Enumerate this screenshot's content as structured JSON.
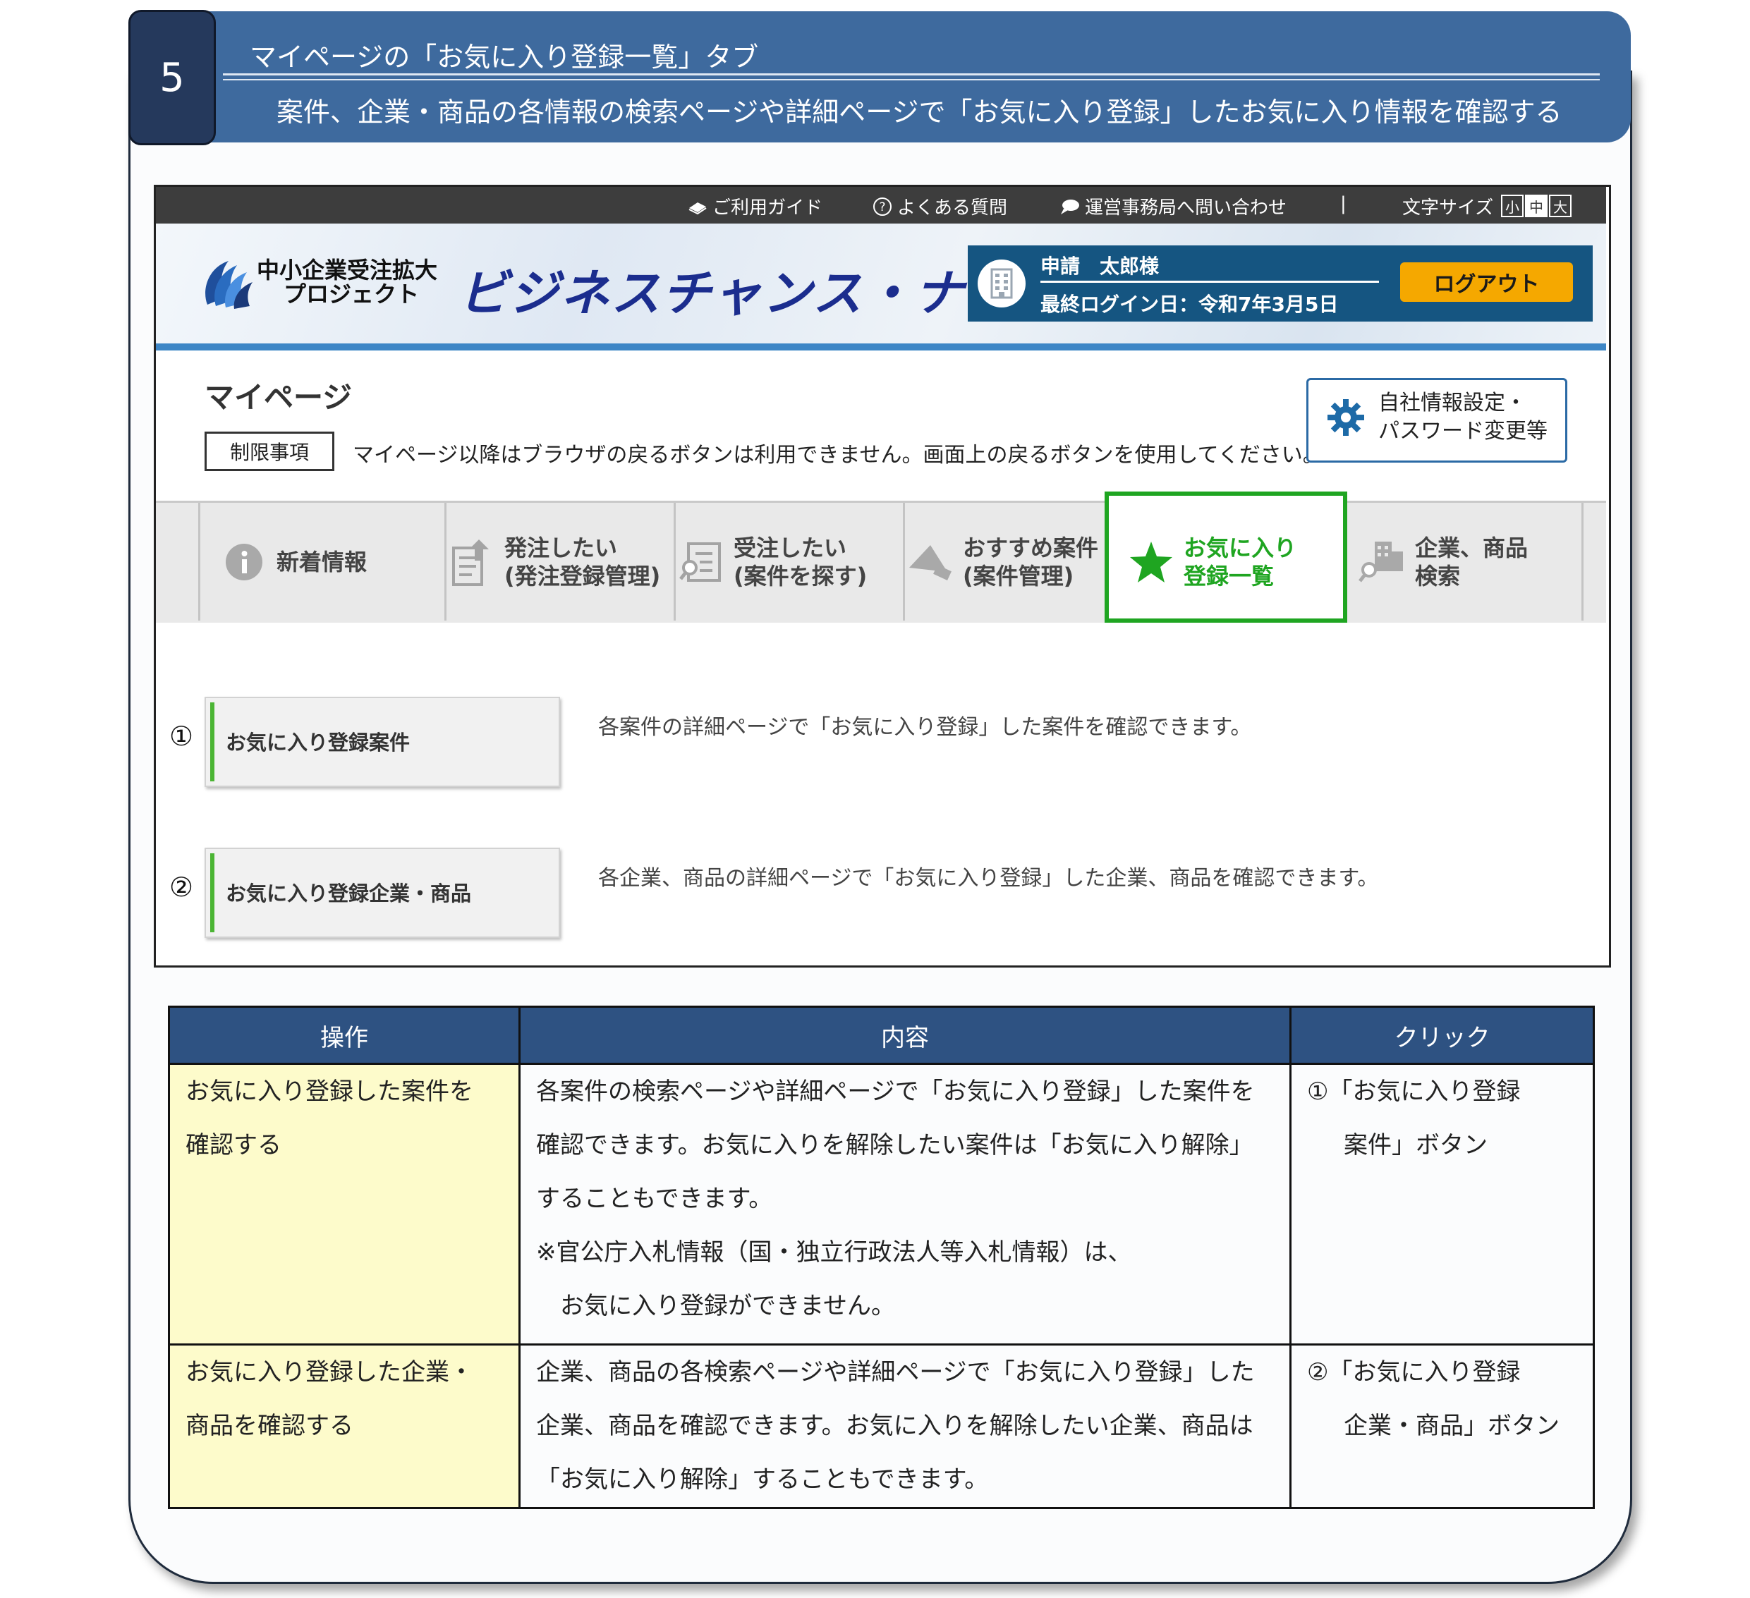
{
  "banner": {
    "number": "5",
    "title": "マイページの「お気に入り登録一覧」タブ",
    "subtitle": "案件、企業・商品の各情報の検索ページや詳細ページで「お気に入り登録」したお気に入り情報を確認する"
  },
  "topbar": {
    "guide": "ご利用ガイド",
    "faq": "よくある質問",
    "contact": "運営事務局へ問い合わせ",
    "separator": "|",
    "font_size_label": "文字サイズ",
    "font_sizes": [
      "小",
      "中",
      "大"
    ]
  },
  "header": {
    "logo_line1": "中小企業受注拡大",
    "logo_line2": "プロジェクト",
    "brand": "ビジネスチャンス・ナビ",
    "user_name": "申請　太郎様",
    "last_login": "最終ログイン日：令和7年3月5日",
    "logout": "ログアウト"
  },
  "mypage": {
    "title": "マイページ",
    "restriction_badge": "制限事項",
    "restriction_text": "マイページ以降はブラウザの戻るボタンは利用できません。画面上の戻るボタンを使用してください。",
    "settings_line1": "自社情報設定・",
    "settings_line2": "パスワード変更等"
  },
  "tabs": [
    {
      "line1": "新着情報",
      "line2": ""
    },
    {
      "line1": "発注したい",
      "line2": "(発注登録管理)"
    },
    {
      "line1": "受注したい",
      "line2": "(案件を探す)"
    },
    {
      "line1": "おすすめ案件",
      "line2": "(案件管理)"
    },
    {
      "line1": "お気に入り",
      "line2": "登録一覧"
    },
    {
      "line1": "企業、商品",
      "line2": "検索"
    }
  ],
  "active_tab_index": 4,
  "list": [
    {
      "marker": "①",
      "label": "お気に入り登録案件",
      "desc": "各案件の詳細ページで「お気に入り登録」した案件を確認できます。"
    },
    {
      "marker": "②",
      "label": "お気に入り登録企業・商品",
      "desc": "各企業、商品の詳細ページで「お気に入り登録」した企業、商品を確認できます。"
    }
  ],
  "table": {
    "headers": [
      "操作",
      "内容",
      "クリック"
    ],
    "rows": [
      {
        "op": [
          "お気に入り登録した案件を",
          "確認する"
        ],
        "content": [
          "各案件の検索ページや詳細ページで「お気に入り登録」した案件を",
          "確認できます。お気に入りを解除したい案件は「お気に入り解除」",
          "することもできます。",
          "※官公庁入札情報（国・独立行政法人等入札情報）は、",
          "お気に入り登録ができません。"
        ],
        "click": [
          "①「お気に入り登録",
          "案件」ボタン"
        ]
      },
      {
        "op": [
          "お気に入り登録した企業・",
          "商品を確認する"
        ],
        "content": [
          "企業、商品の各検索ページや詳細ページで「お気に入り登録」した",
          "企業、商品を確認できます。お気に入りを解除したい企業、商品は",
          "「お気に入り解除」することもできます。"
        ],
        "click": [
          "②「お気に入り登録",
          "企業・商品」ボタン"
        ]
      }
    ]
  },
  "colors": {
    "banner": "#3e6a9e",
    "header_bar": "#155581",
    "logout": "#f5a800",
    "active_tab_border": "#1fa521",
    "table_header": "#2e5282",
    "op_cell": "#fdfbcb"
  }
}
